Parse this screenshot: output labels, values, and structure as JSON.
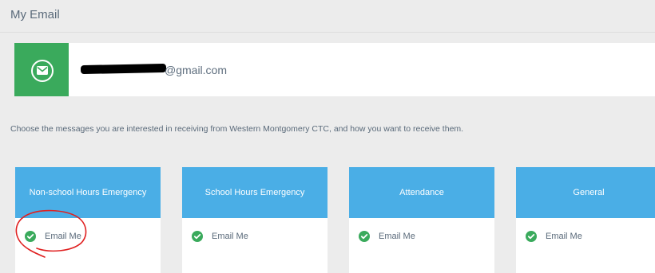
{
  "page": {
    "title": "My Email"
  },
  "email": {
    "address_suffix": "@gmail.com",
    "icon": "envelope-icon"
  },
  "instructions": "Choose the messages you are interested in receiving from Western Montgomery CTC, and how you want to receive them.",
  "categories": [
    {
      "title": "Non-school Hours Emergency",
      "option_label": "Email Me",
      "checked": true
    },
    {
      "title": "School Hours Emergency",
      "option_label": "Email Me",
      "checked": true
    },
    {
      "title": "Attendance",
      "option_label": "Email Me",
      "checked": true
    },
    {
      "title": "General",
      "option_label": "Email Me",
      "checked": true
    }
  ],
  "colors": {
    "background": "#ececec",
    "email_icon_bg": "#3aaa5c",
    "category_header_bg": "#4aaee6",
    "check_green": "#3aaa5c",
    "annotation_red": "#e02020"
  }
}
